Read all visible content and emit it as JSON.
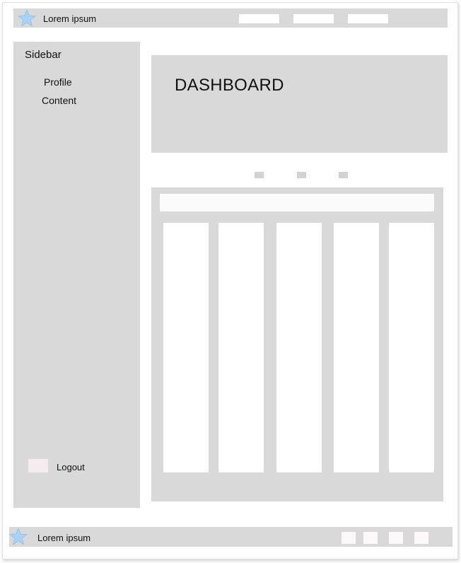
{
  "header": {
    "title": "Lorem ipsum",
    "icon": "star-icon",
    "nav_links": [
      "",
      "",
      ""
    ]
  },
  "sidebar": {
    "heading": "Sidebar",
    "items": [
      {
        "label": "Profile"
      },
      {
        "label": "Content"
      }
    ],
    "logout_label": "Logout"
  },
  "dashboard": {
    "title": "DASHBOARD"
  },
  "pager": {
    "dots": 3
  },
  "board": {
    "columns": 5
  },
  "footer": {
    "title": "Lorem ipsum",
    "icon": "star-icon",
    "buttons": 4
  },
  "colors": {
    "panel": "#d9d9d9",
    "star": "#a9d2f5",
    "logout_icon": "#f4ecef"
  }
}
